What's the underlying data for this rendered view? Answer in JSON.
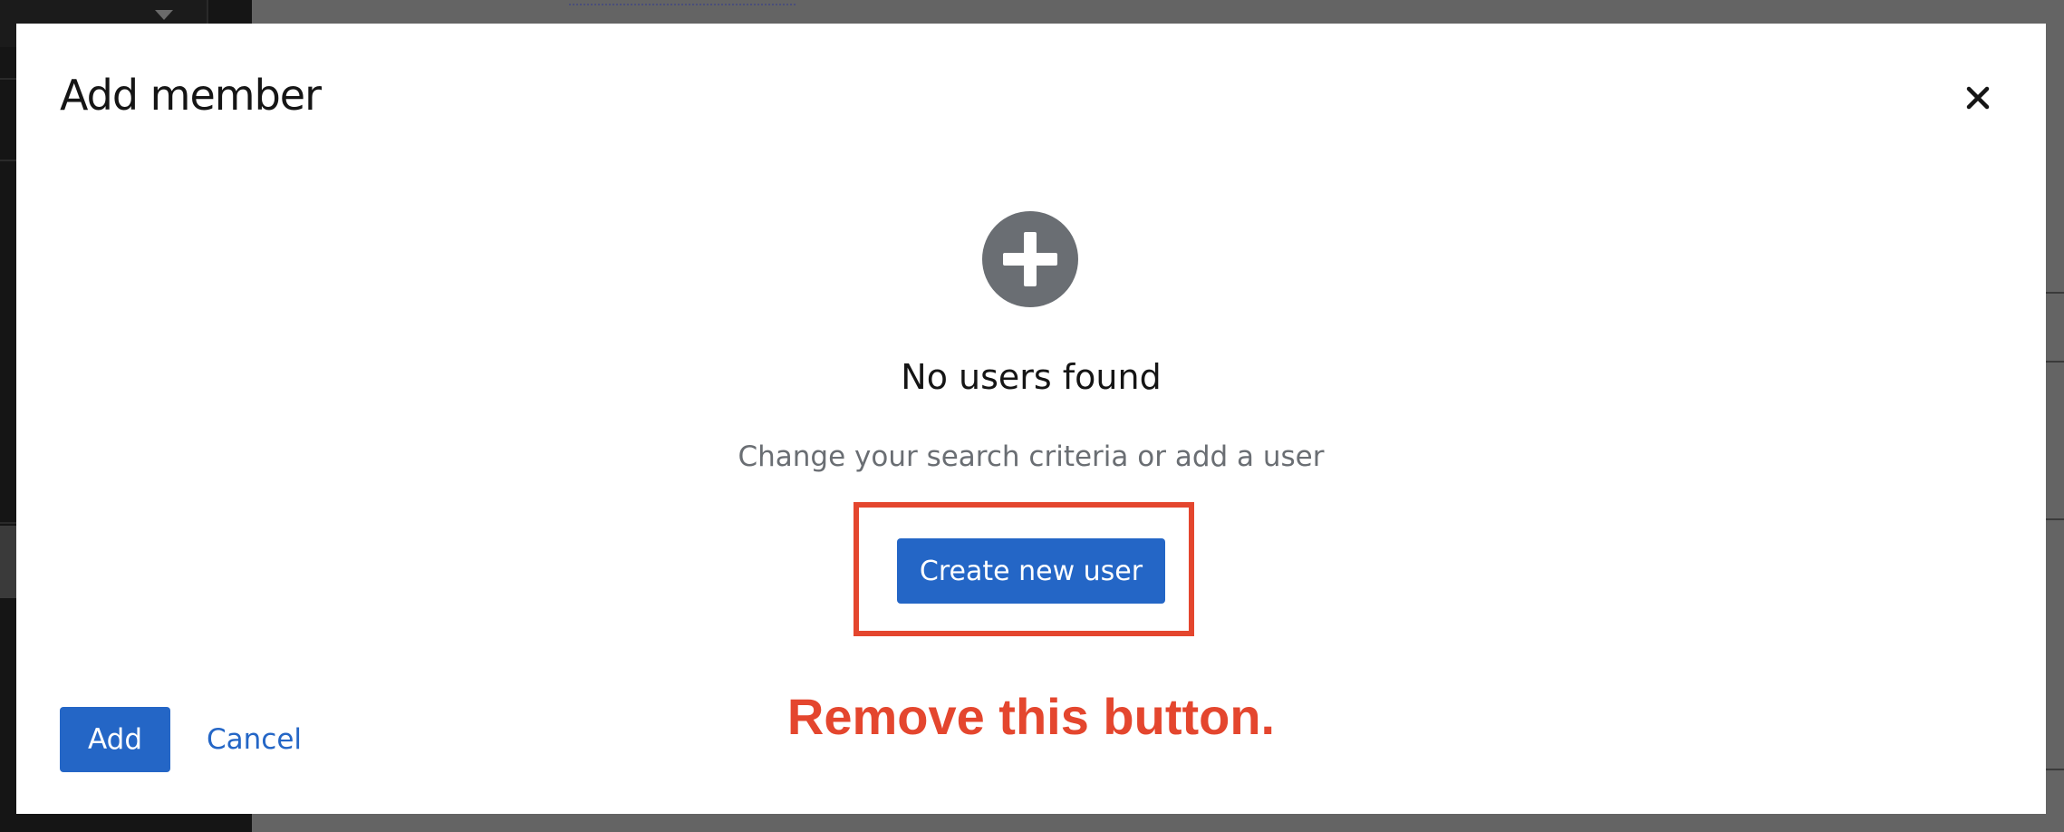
{
  "modal": {
    "title": "Add member",
    "close_icon": "close-icon"
  },
  "empty_state": {
    "icon": "plus-circle-icon",
    "title": "No users found",
    "body": "Change your search criteria or add a user",
    "action_label": "Create new user"
  },
  "annotation": {
    "text": "Remove this button.",
    "color": "#e4462e"
  },
  "footer": {
    "add_label": "Add",
    "cancel_label": "Cancel"
  },
  "colors": {
    "primary": "#2466c6",
    "backdrop": "#646464",
    "icon_gray": "#6a6e73"
  }
}
